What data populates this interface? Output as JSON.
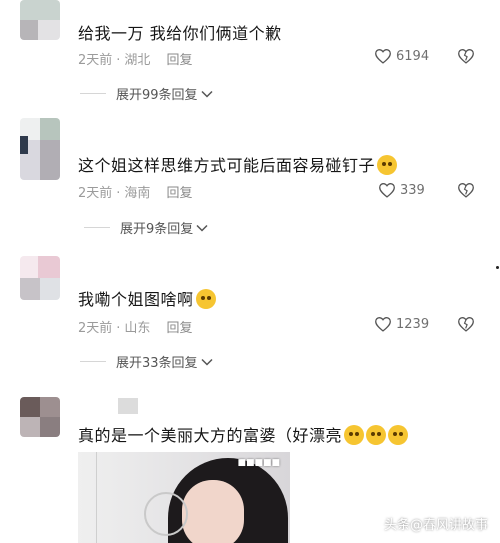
{
  "colors": {
    "text": "#161616",
    "meta": "#9b9b9b",
    "like_icon": "#555555",
    "emoji": "#f6c531"
  },
  "comments": [
    {
      "text": "给我一万 我给你们俩道个歉",
      "time": "2天前",
      "location": "湖北",
      "reply_label": "回复",
      "likes": "6194",
      "expand_label": "展开99条回复"
    },
    {
      "text": "这个姐这样思维方式可能后面容易碰钉子",
      "time": "2天前",
      "location": "海南",
      "reply_label": "回复",
      "likes": "339",
      "expand_label": "展开9条回复"
    },
    {
      "text": "我嘞个姐图啥啊",
      "time": "2天前",
      "location": "山东",
      "reply_label": "回复",
      "likes": "1239",
      "expand_label": "展开33条回复"
    },
    {
      "text": "真的是一个美丽大方的富婆（好漂亮"
    }
  ],
  "watermark": "头条@春风讲故事"
}
